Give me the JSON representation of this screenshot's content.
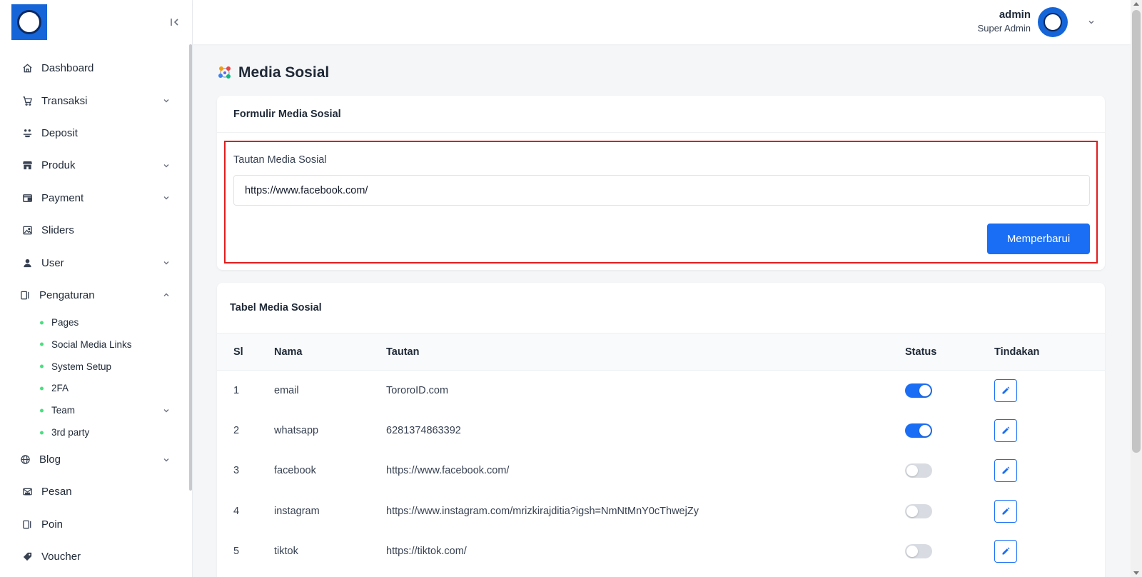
{
  "header": {
    "user_name": "admin",
    "user_role": "Super Admin"
  },
  "sidebar": {
    "items": [
      {
        "label": "Dashboard",
        "icon": "home-icon",
        "has_children": false
      },
      {
        "label": "Transaksi",
        "icon": "cart-icon",
        "has_children": true
      },
      {
        "label": "Deposit",
        "icon": "deposit-icon",
        "has_children": false
      },
      {
        "label": "Produk",
        "icon": "store-icon",
        "has_children": true
      },
      {
        "label": "Payment",
        "icon": "wallet-icon",
        "has_children": true
      },
      {
        "label": "Sliders",
        "icon": "image-icon",
        "has_children": false
      },
      {
        "label": "User",
        "icon": "user-icon",
        "has_children": true
      },
      {
        "label": "Pengaturan",
        "icon": "settings-panel-icon",
        "has_children": true,
        "expanded": true
      },
      {
        "label": "Blog",
        "icon": "globe-icon",
        "has_children": true
      },
      {
        "label": "Pesan",
        "icon": "mail-icon",
        "has_children": false
      },
      {
        "label": "Poin",
        "icon": "panel-icon",
        "has_children": false
      },
      {
        "label": "Voucher",
        "icon": "tag-icon",
        "has_children": false
      }
    ],
    "pengaturan_children": [
      {
        "label": "Pages",
        "has_children": false
      },
      {
        "label": "Social Media Links",
        "has_children": false,
        "active": true
      },
      {
        "label": "System Setup",
        "has_children": false
      },
      {
        "label": "2FA",
        "has_children": false
      },
      {
        "label": "Team",
        "has_children": true
      },
      {
        "label": "3rd party",
        "has_children": false
      }
    ]
  },
  "page": {
    "title": "Media Sosial"
  },
  "form": {
    "card_title": "Formulir Media Sosial",
    "field_label": "Tautan Media Sosial",
    "field_value": "https://www.facebook.com/",
    "submit_label": "Memperbarui"
  },
  "table": {
    "card_title": "Tabel Media Sosial",
    "headers": {
      "sl": "Sl",
      "name": "Nama",
      "link": "Tautan",
      "status": "Status",
      "action": "Tindakan"
    },
    "rows": [
      {
        "sl": "1",
        "name": "email",
        "link": "TororoID.com",
        "status_on": true
      },
      {
        "sl": "2",
        "name": "whatsapp",
        "link": "6281374863392",
        "status_on": true
      },
      {
        "sl": "3",
        "name": "facebook",
        "link": "https://www.facebook.com/",
        "status_on": false
      },
      {
        "sl": "4",
        "name": "instagram",
        "link": "https://www.instagram.com/mrizkirajditia?igsh=NmNtMnY0cThwejZy",
        "status_on": false
      },
      {
        "sl": "5",
        "name": "tiktok",
        "link": "https://tiktok.com/",
        "status_on": false
      }
    ]
  },
  "colors": {
    "accent": "#1a6ef5",
    "highlight": "#e11d1d",
    "sub_dot": "#4ade80"
  }
}
